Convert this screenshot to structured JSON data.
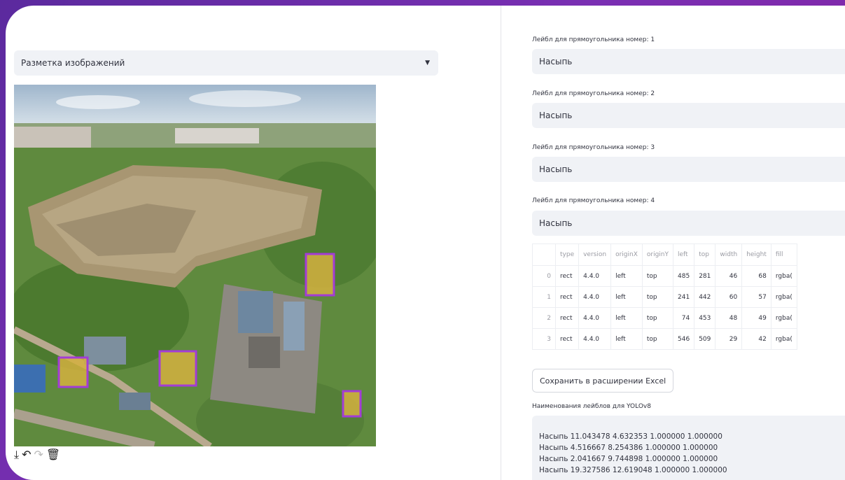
{
  "left": {
    "selectbox": {
      "value": "Разметка изображений"
    },
    "toolbar": [
      "download-icon",
      "undo-icon",
      "redo-icon",
      "trash-icon"
    ]
  },
  "right": {
    "labels": [
      {
        "caption": "Лейбл для прямоугольника номер: 1",
        "value": "Насыпь"
      },
      {
        "caption": "Лейбл для прямоугольника номер: 2",
        "value": "Насыпь"
      },
      {
        "caption": "Лейбл для прямоугольника номер: 3",
        "value": "Насыпь"
      },
      {
        "caption": "Лейбл для прямоугольника номер: 4",
        "value": "Насыпь"
      }
    ],
    "table": {
      "columns": [
        "",
        "type",
        "version",
        "originX",
        "originY",
        "left",
        "top",
        "width",
        "height",
        "fill"
      ],
      "rows": [
        [
          "0",
          "rect",
          "4.4.0",
          "left",
          "top",
          "485",
          "281",
          "46",
          "68",
          "rgba("
        ],
        [
          "1",
          "rect",
          "4.4.0",
          "left",
          "top",
          "241",
          "442",
          "60",
          "57",
          "rgba("
        ],
        [
          "2",
          "rect",
          "4.4.0",
          "left",
          "top",
          "74",
          "453",
          "48",
          "49",
          "rgba("
        ],
        [
          "3",
          "rect",
          "4.4.0",
          "left",
          "top",
          "546",
          "509",
          "29",
          "42",
          "rgba("
        ]
      ]
    },
    "save_button": "Сохранить в расширении Excel",
    "yolo_caption": "Наименования лейблов для YOLOv8",
    "yolo_lines": [
      "Насыпь 11.043478 4.632353 1.000000 1.000000",
      "Насыпь 4.516667 8.254386 1.000000 1.000000",
      "Насыпь 2.041667 9.744898 1.000000 1.000000",
      "Насыпь 19.327586 12.619048 1.000000 1.000000"
    ]
  },
  "colors": {
    "accent": "#a33cd6",
    "bbox_fill": "#d4b040",
    "background": "#6a2aa6"
  }
}
